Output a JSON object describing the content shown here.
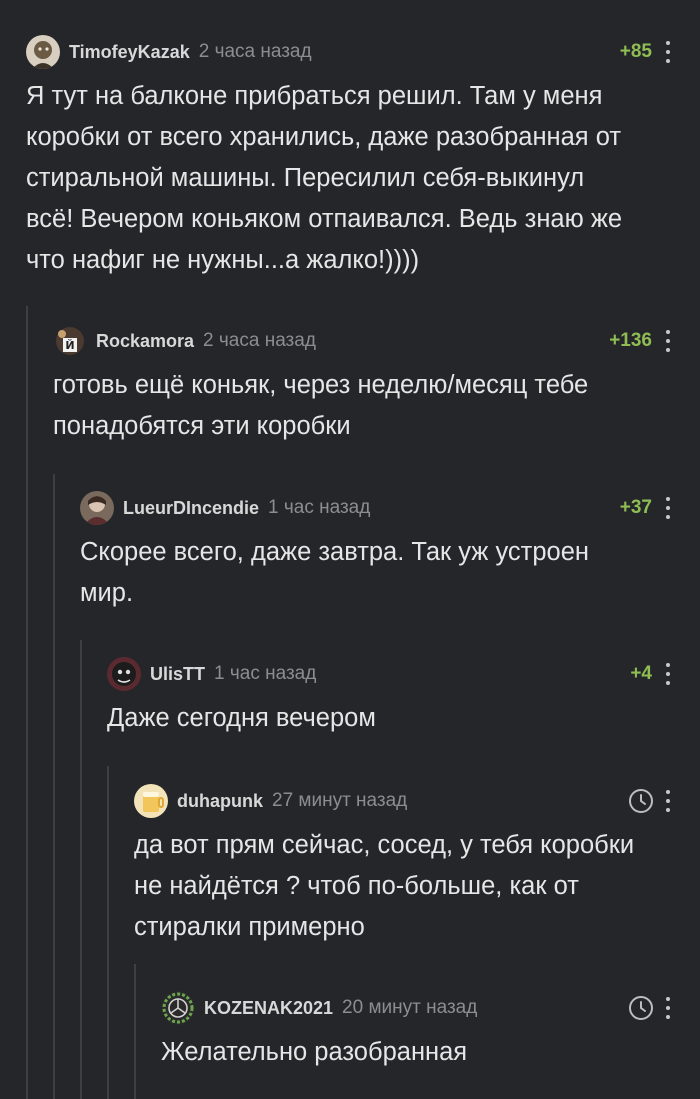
{
  "comments": [
    {
      "username": "TimofeyKazak",
      "time": "2 часа назад",
      "rating": "+85",
      "text": "Я тут на балконе прибраться решил. Там у меня\nкоробки от всего хранились, даже разобранная от\nстиральной машины. Пересилил себя-выкинул\nвсё! Вечером коньяком отпаивался. Ведь знаю же\nчто нафиг не нужны...а жалко!))))"
    },
    {
      "username": "Rockamora",
      "time": "2 часа назад",
      "rating": "+136",
      "text": "готовь ещё коньяк, через неделю/месяц тебе\nпонадобятся эти коробки"
    },
    {
      "username": "LueurDIncendie",
      "time": "1 час назад",
      "rating": "+37",
      "text": "Скорее всего, даже завтра. Так уж устроен\nмир."
    },
    {
      "username": "UlisTT",
      "time": "1 час назад",
      "rating": "+4",
      "text": "Даже сегодня вечером"
    },
    {
      "username": "duhapunk",
      "time": "27 минут назад",
      "rating": "",
      "text": "да вот прям сейчас, сосед, у тебя коробки\nне найдётся ? чтоб по-больше, как от\nстиралки примерно"
    },
    {
      "username": "KOZENAK2021",
      "time": "20 минут назад",
      "rating": "",
      "text": "Желательно разобранная"
    }
  ],
  "colors": {
    "background": "#25262a",
    "rating_positive": "#8fbd53",
    "thread_line": "#3e3f44",
    "timestamp": "#8c8d92"
  },
  "icons": [
    "avatar",
    "clock-icon",
    "more-options-icon"
  ]
}
